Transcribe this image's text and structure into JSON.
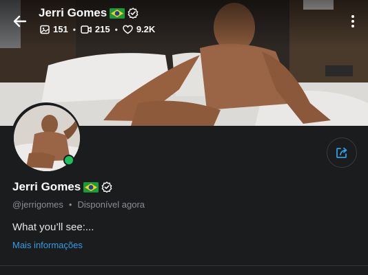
{
  "header": {
    "title": "Jerri Gomes",
    "stats": {
      "photos": "151",
      "videos": "215",
      "likes": "9.2K"
    },
    "separator": "•"
  },
  "profile": {
    "name": "Jerri Gomes",
    "handle": "@jerrigomes",
    "separator": "•",
    "status": "Disponível agora",
    "bio": "What you’ll see:...",
    "more_info": "Mais informações",
    "online": true
  },
  "icons": {
    "back": "arrow-left-icon",
    "photo": "image-icon",
    "video": "video-icon",
    "like": "heart-icon",
    "more": "more-vertical-icon",
    "share": "share-icon",
    "flag": "brazil-flag-icon",
    "verified": "verified-badge-icon"
  },
  "colors": {
    "background": "#1b1c1e",
    "link": "#2f9fe6",
    "online": "#1fbf5f",
    "muted_text": "#8a8d93"
  }
}
